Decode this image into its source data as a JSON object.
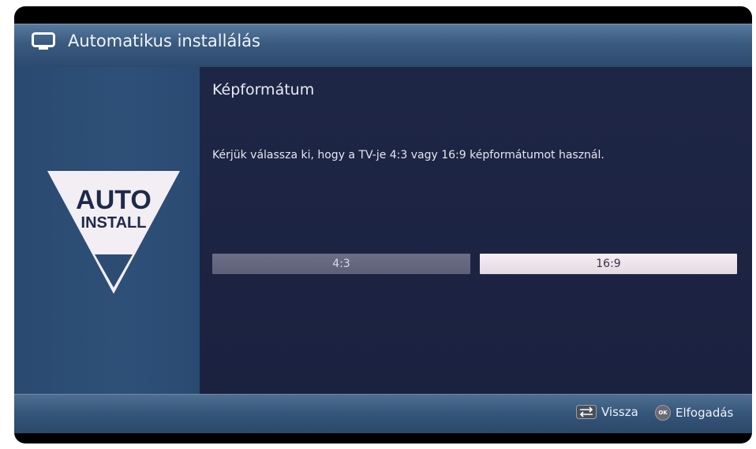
{
  "header": {
    "title": "Automatikus installálás",
    "icon": "tv-icon"
  },
  "logo": {
    "line1": "AUTO",
    "line2": "INSTALL"
  },
  "main": {
    "heading": "Képformátum",
    "message": "Kérjük válassza ki, hogy a TV-je 4:3 vagy 16:9 képformátumot használ.",
    "options": [
      {
        "label": "4:3",
        "selected": false
      },
      {
        "label": "16:9",
        "selected": true
      }
    ]
  },
  "footer": {
    "back_label": "Vissza",
    "back_icon": "back-arrows-icon",
    "ok_badge": "OK",
    "ok_label": "Elfogadás"
  },
  "colors": {
    "title_bar": "#3a5a80",
    "content_bg": "#1c2440",
    "selected_option": "#e4d9e2",
    "unselected_option": "#5e6078"
  }
}
